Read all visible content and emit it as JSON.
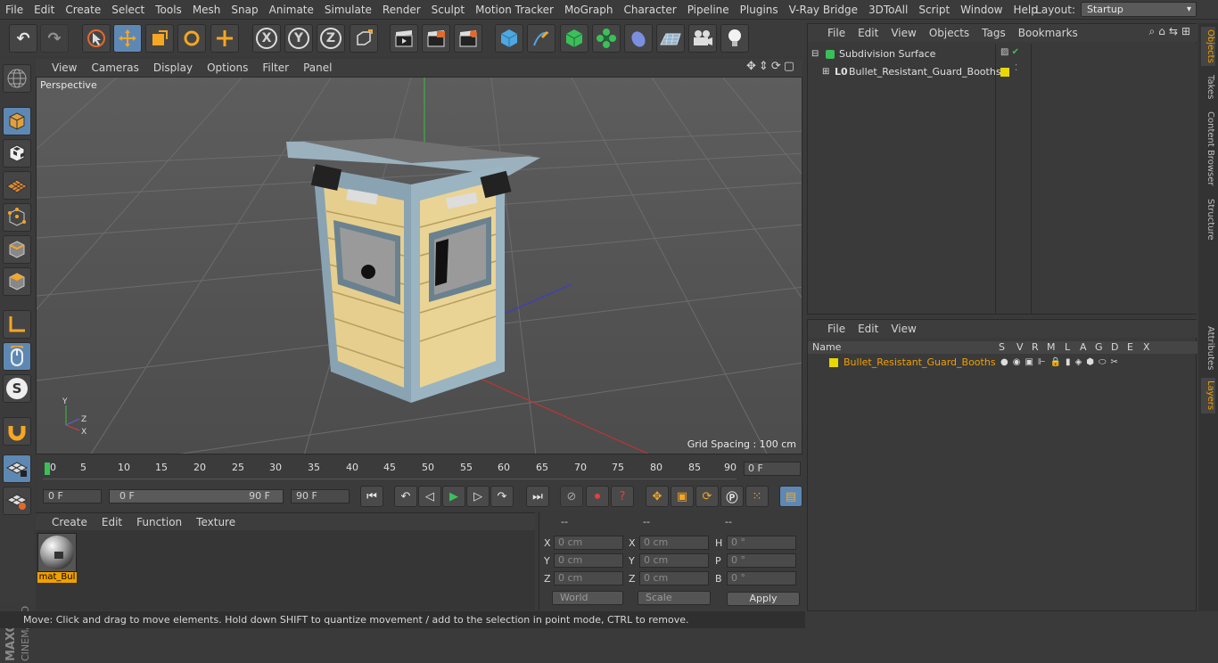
{
  "menubar": {
    "items": [
      "File",
      "Edit",
      "Create",
      "Select",
      "Tools",
      "Mesh",
      "Snap",
      "Animate",
      "Simulate",
      "Render",
      "Sculpt",
      "Motion Tracker",
      "MoGraph",
      "Character",
      "Pipeline",
      "Plugins",
      "V-Ray Bridge",
      "3DToAll",
      "Script",
      "Window",
      "Help"
    ],
    "layout_label": "Layout:",
    "layout_value": "Startup"
  },
  "viewport": {
    "menu": [
      "View",
      "Cameras",
      "Display",
      "Options",
      "Filter",
      "Panel"
    ],
    "label": "Perspective",
    "grid_spacing": "Grid Spacing : 100 cm"
  },
  "timeline": {
    "ticks": [
      "0",
      "5",
      "10",
      "15",
      "20",
      "25",
      "30",
      "35",
      "40",
      "45",
      "50",
      "55",
      "60",
      "65",
      "70",
      "75",
      "80",
      "85",
      "90"
    ],
    "current_frame": "0 F"
  },
  "transport": {
    "start_field": "0 F",
    "range_start": "0 F",
    "range_end": "90 F",
    "end_field": "90 F"
  },
  "material": {
    "menu": [
      "Create",
      "Edit",
      "Function",
      "Texture"
    ],
    "thumb_name": "mat_Bul"
  },
  "coordinates": {
    "head": [
      "--",
      "--",
      "--"
    ],
    "rows": [
      {
        "l1": "X",
        "v1": "0 cm",
        "l2": "X",
        "v2": "0 cm",
        "l3": "H",
        "v3": "0 °"
      },
      {
        "l1": "Y",
        "v1": "0 cm",
        "l2": "Y",
        "v2": "0 cm",
        "l3": "P",
        "v3": "0 °"
      },
      {
        "l1": "Z",
        "v1": "0 cm",
        "l2": "Z",
        "v2": "0 cm",
        "l3": "B",
        "v3": "0 °"
      }
    ],
    "mode_world": "World",
    "mode_scale": "Scale",
    "apply": "Apply"
  },
  "status": "Move: Click and drag to move elements. Hold down SHIFT to quantize movement / add to the selection in point mode, CTRL to remove.",
  "objects": {
    "menu": [
      "File",
      "Edit",
      "View",
      "Objects",
      "Tags",
      "Bookmarks"
    ],
    "items": [
      {
        "name": "Subdivision Surface"
      },
      {
        "name": "Bullet_Resistant_Guard_Booths"
      }
    ]
  },
  "right_tabs": [
    "Objects",
    "Takes",
    "Content Browser",
    "Structure",
    "Attributes",
    "Layers"
  ],
  "layers": {
    "menu": [
      "File",
      "Edit",
      "View"
    ],
    "headers": [
      "Name",
      "S",
      "V",
      "R",
      "M",
      "L",
      "A",
      "G",
      "D",
      "E",
      "X"
    ],
    "row_name": "Bullet_Resistant_Guard_Booths"
  },
  "colors": {
    "accent_blue": "#5e88b4",
    "selection_orange": "#f0a000",
    "layer_yellow": "#e8d800"
  }
}
